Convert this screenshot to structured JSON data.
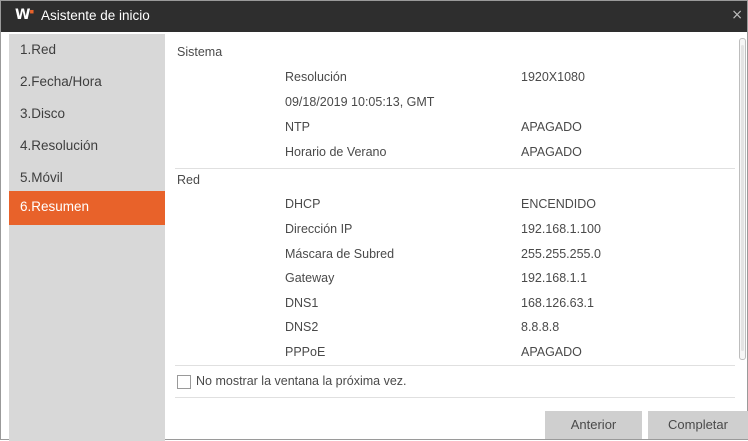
{
  "window": {
    "title": "Asistente de inicio",
    "logo": "W",
    "close_glyph": "×"
  },
  "sidebar": {
    "items": [
      {
        "label": "1.Red"
      },
      {
        "label": "2.Fecha/Hora"
      },
      {
        "label": "3.Disco"
      },
      {
        "label": "4.Resolución"
      },
      {
        "label": "5.Móvil"
      },
      {
        "label": "6.Resumen",
        "active": true
      }
    ]
  },
  "summary": {
    "sistema": {
      "heading": "Sistema",
      "rows": [
        {
          "label": "Resolución",
          "value": "1920X1080"
        },
        {
          "label": "09/18/2019 10:05:13, GMT",
          "value": ""
        },
        {
          "label": "NTP",
          "value": "APAGADO"
        },
        {
          "label": "Horario de Verano",
          "value": "APAGADO"
        }
      ]
    },
    "red": {
      "heading": "Red",
      "rows": [
        {
          "label": "DHCP",
          "value": "ENCENDIDO"
        },
        {
          "label": "Dirección IP",
          "value": "192.168.1.100"
        },
        {
          "label": "Máscara de Subred",
          "value": "255.255.255.0"
        },
        {
          "label": "Gateway",
          "value": "192.168.1.1"
        },
        {
          "label": "DNS1",
          "value": "168.126.63.1"
        },
        {
          "label": "DNS2",
          "value": "8.8.8.8"
        },
        {
          "label": "PPPoE",
          "value": "APAGADO"
        }
      ]
    }
  },
  "footer": {
    "checkbox_label": "No mostrar la ventana la próxima vez.",
    "checkbox_checked": false,
    "prev_label": "Anterior",
    "finish_label": "Completar"
  },
  "colors": {
    "accent": "#e8622a",
    "titlebar": "#2e2e2e",
    "sidebar": "#d8d8d8"
  }
}
